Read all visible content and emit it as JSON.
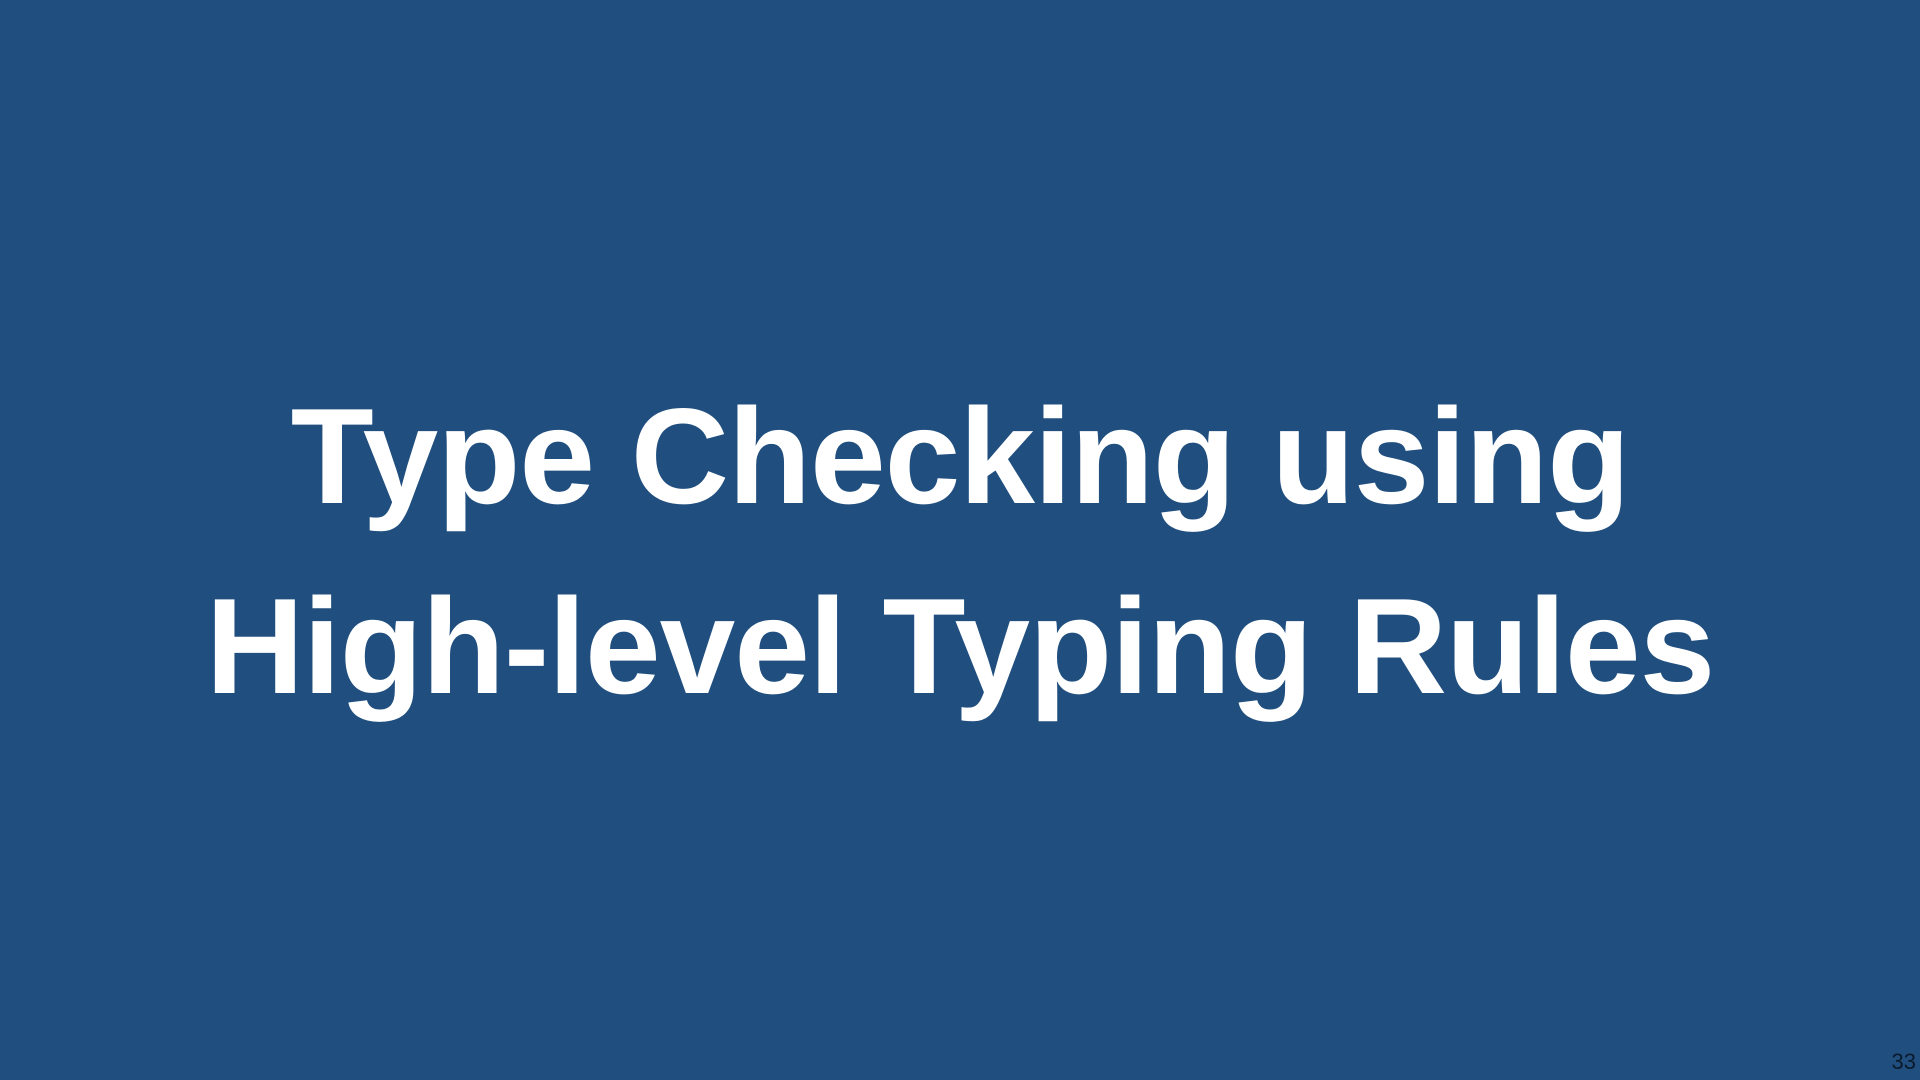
{
  "slide": {
    "title_line_1": "Type Checking using",
    "title_line_2": "High-level Typing Rules",
    "page_number": "33"
  },
  "colors": {
    "background": "#204f7f",
    "title_text": "#ffffff",
    "page_number_text": "#0b1a2a"
  }
}
